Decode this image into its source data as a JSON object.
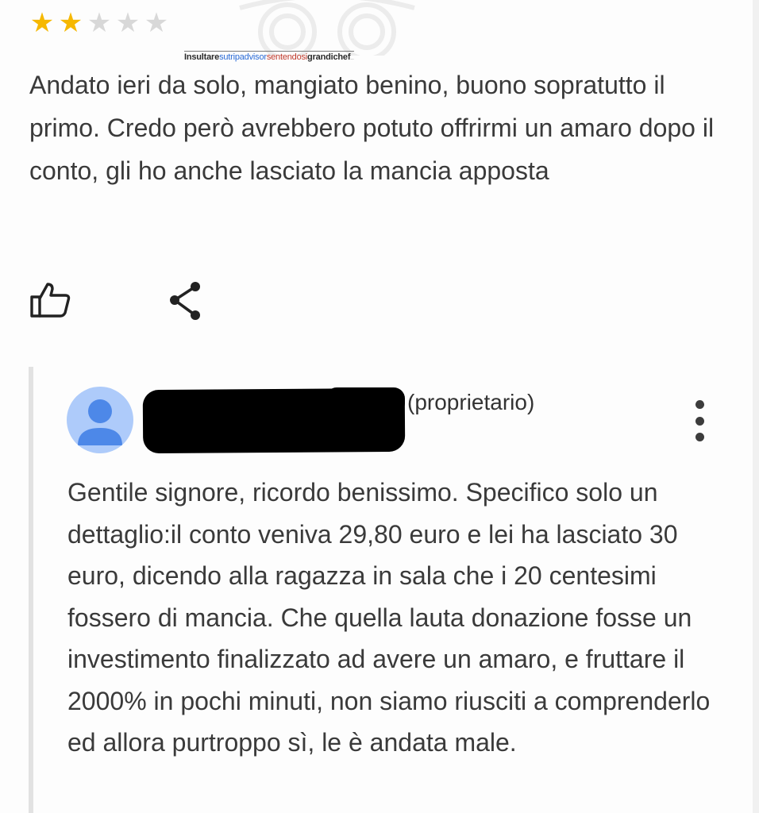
{
  "review": {
    "rating": 2,
    "max_rating": 5,
    "text": "Andato ieri da solo, mangiato benino, buono sopratutto il primo. Credo però avrebbero potuto offrirmi un amaro dopo il conto, gli ho anche lasciato la mancia apposta",
    "like_icon": "thumbs-up-icon",
    "share_icon": "share-icon"
  },
  "watermark": {
    "part_a": "Insultare",
    "part_b": "sutripadvisor",
    "part_c": "sentendosi",
    "part_d": "grandichef",
    "part_e": "..."
  },
  "owner_reply": {
    "avatar_icon": "user-avatar-icon",
    "owner_name_redacted": "",
    "role": "(proprietario)",
    "menu_icon": "more-vertical-icon",
    "text": "Gentile signore, ricordo benissimo. Specifico solo un dettaglio:il conto veniva 29,80 euro e lei ha lasciato 30 euro, dicendo alla ragazza in sala che i 20 centesimi fossero di mancia. Che quella lauta donazione fosse un investimento finalizzato ad avere un amaro, e fruttare il 2000% in pochi minuti, non siamo riusciti a comprenderlo ed allora purtroppo sì, le è andata male."
  },
  "colors": {
    "star_filled": "#f6b800",
    "star_empty": "#d8d8d8",
    "avatar_bg": "#aecbfa",
    "avatar_fg": "#4d88e8",
    "text": "#3a3a3a"
  }
}
